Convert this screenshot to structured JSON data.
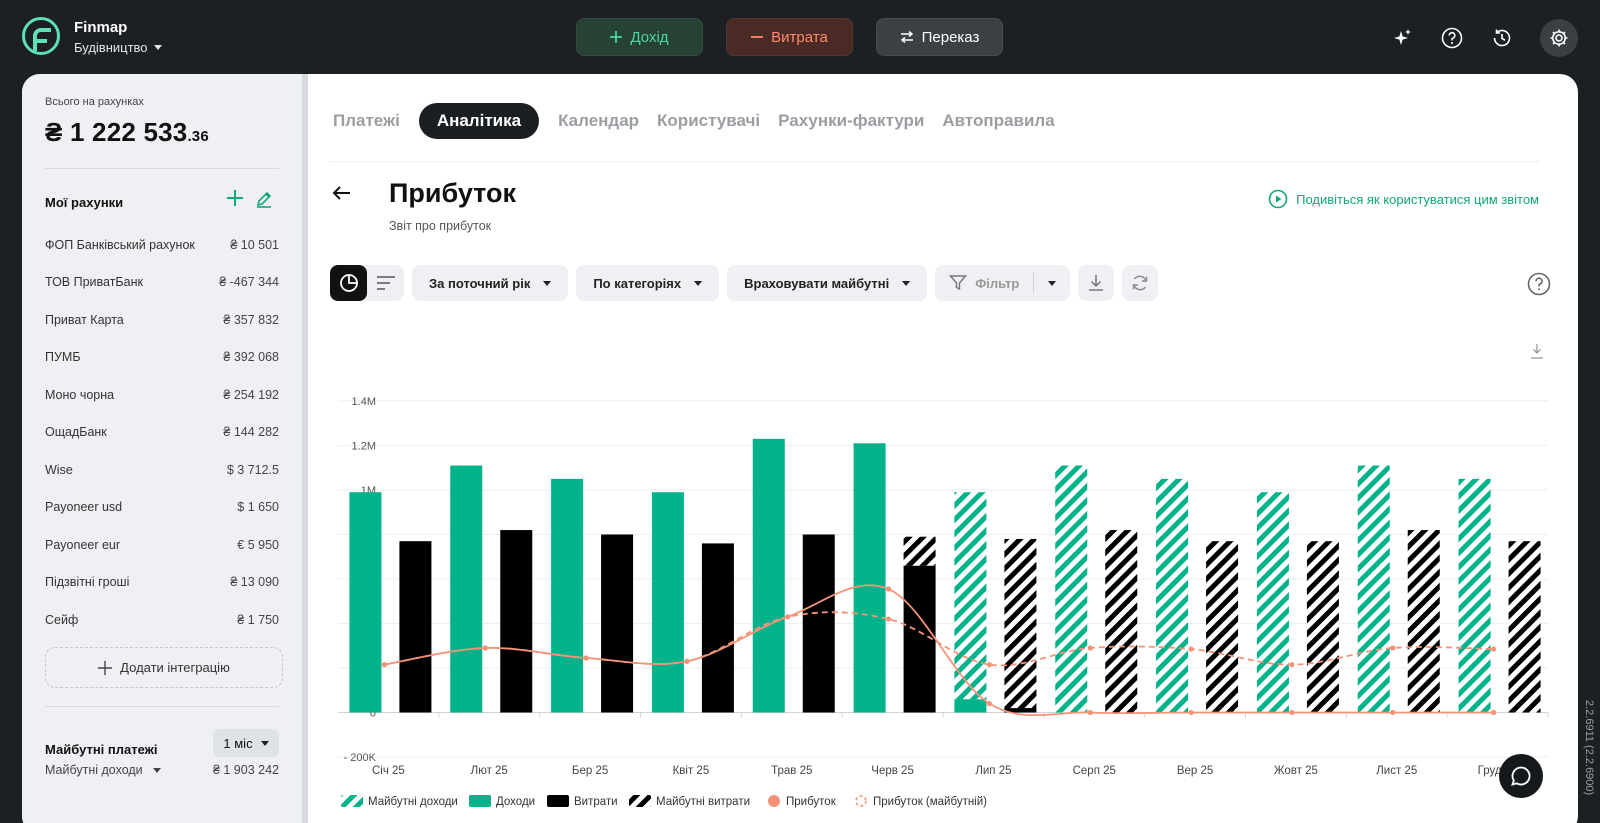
{
  "app": {
    "name": "Finmap",
    "company": "Будівництво"
  },
  "top_actions": {
    "income": "Дохід",
    "expense": "Витрата",
    "transfer": "Переказ"
  },
  "sidebar": {
    "total_label": "Всього на рахунках",
    "total_main": "₴ 1 222 533",
    "total_cents": ".36",
    "accounts_title": "Мої рахунки",
    "accounts": [
      {
        "name": "ФОП Банківський рахунок",
        "value": "₴ 10 501"
      },
      {
        "name": "ТОВ ПриватБанк",
        "value": "₴ -467 344"
      },
      {
        "name": "Приват Карта",
        "value": "₴ 357 832"
      },
      {
        "name": "ПУМБ",
        "value": "₴ 392 068"
      },
      {
        "name": "Моно чорна",
        "value": "₴ 254 192"
      },
      {
        "name": "ОщадБанк",
        "value": "₴ 144 282"
      },
      {
        "name": "Wise",
        "value": "$ 3 712.5"
      },
      {
        "name": "Payoneer usd",
        "value": "$ 1 650"
      },
      {
        "name": "Payoneer eur",
        "value": "€ 5 950"
      },
      {
        "name": "Підзвітні гроші",
        "value": "₴ 13 090"
      },
      {
        "name": "Сейф",
        "value": "₴ 1 750"
      }
    ],
    "add_integration": "Додати інтеграцію",
    "future_title": "Майбутні платежі",
    "future_period": "1 міс",
    "future_income_label": "Майбутні доходи",
    "future_income_value": "₴ 1 903 242"
  },
  "tabs": [
    "Платежі",
    "Аналітика",
    "Календар",
    "Користувачі",
    "Рахунки-фактури",
    "Автоправила"
  ],
  "active_tab": 1,
  "report": {
    "title": "Прибуток",
    "subtitle": "Звіт про прибуток",
    "howto": "Подивіться як користуватися цим звітом"
  },
  "toolbar": {
    "period": "За поточний рік",
    "grouping": "По категоріях",
    "future": "Враховувати майбутні",
    "filter": "Фільтр"
  },
  "colors": {
    "income": "#00b38a",
    "expense": "#000000",
    "profit": "#f59378",
    "accent": "#12a77c"
  },
  "icons": [
    "logo-icon",
    "plus-icon",
    "minus-icon",
    "transfer-icon",
    "sparkle-icon",
    "help-icon",
    "history-icon",
    "gear-icon",
    "edit-icon",
    "back-arrow-icon",
    "play-circle-icon",
    "pie-chart-icon",
    "list-icon",
    "filter-icon",
    "download-icon",
    "refresh-icon",
    "chat-icon"
  ],
  "chart_data": {
    "type": "bar",
    "categories": [
      "Січ 25",
      "Лют 25",
      "Бер 25",
      "Квіт 25",
      "Трав 25",
      "Черв 25",
      "Лип 25",
      "Серп 25",
      "Вер 25",
      "Жовт 25",
      "Лист 25",
      "Груд 25"
    ],
    "ylim": [
      -200000,
      1400000
    ],
    "yticks": [
      "- 200K",
      "0",
      "200K",
      "400K",
      "600K",
      "800K",
      "1M",
      "1.2M",
      "1.4M"
    ],
    "grid": true,
    "legend_position": "bottom-left",
    "series": [
      {
        "name": "Майбутні доходи",
        "kind": "bar-hatched",
        "color": "#00b38a",
        "values": [
          0,
          0,
          0,
          0,
          0,
          0,
          930000,
          1110000,
          1050000,
          990000,
          1110000,
          1050000
        ]
      },
      {
        "name": "Доходи",
        "kind": "bar",
        "color": "#00b38a",
        "values": [
          990000,
          1110000,
          1050000,
          990000,
          1230000,
          1210000,
          60000,
          0,
          0,
          0,
          0,
          0
        ]
      },
      {
        "name": "Витрати",
        "kind": "bar",
        "color": "#000000",
        "values": [
          770000,
          820000,
          800000,
          760000,
          800000,
          660000,
          20000,
          0,
          0,
          0,
          0,
          0
        ]
      },
      {
        "name": "Майбутні витрати",
        "kind": "bar-hatched",
        "color": "#000000",
        "values": [
          0,
          0,
          0,
          0,
          0,
          130000,
          760000,
          820000,
          770000,
          770000,
          820000,
          770000
        ]
      },
      {
        "name": "Прибуток",
        "kind": "line",
        "color": "#f59378",
        "values": [
          215000,
          290000,
          245000,
          230000,
          430000,
          555000,
          40000,
          0,
          0,
          0,
          0,
          0
        ]
      },
      {
        "name": "Прибуток (майбутній)",
        "kind": "line-dashed",
        "color": "#f59378",
        "values": [
          215000,
          290000,
          245000,
          230000,
          430000,
          420000,
          215000,
          290000,
          285000,
          215000,
          290000,
          285000
        ]
      }
    ],
    "version": "2.2.6911 (2.2.6900)"
  }
}
